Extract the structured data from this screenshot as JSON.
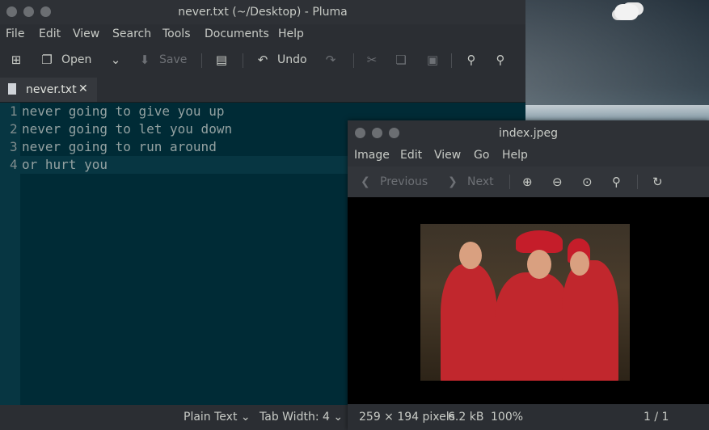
{
  "pluma": {
    "title": "never.txt (~/Desktop) - Pluma",
    "menu": [
      "File",
      "Edit",
      "View",
      "Search",
      "Tools",
      "Documents",
      "Help"
    ],
    "toolbar": {
      "open_label": "Open",
      "save_label": "Save",
      "undo_label": "Undo"
    },
    "tab": {
      "name": "never.txt",
      "close": "✕"
    },
    "lines": [
      {
        "num": "1",
        "text": "never going to give you up"
      },
      {
        "num": "2",
        "text": "never going to let you down"
      },
      {
        "num": "3",
        "text": "never going to run around"
      },
      {
        "num": "4",
        "text": "or hurt you"
      }
    ],
    "status": {
      "syntax": "Plain Text",
      "tab_width": "Tab Width:  4"
    }
  },
  "viewer": {
    "title": "index.jpeg",
    "menu": [
      "Image",
      "Edit",
      "View",
      "Go",
      "Help"
    ],
    "toolbar": {
      "previous_label": "Previous",
      "next_label": "Next"
    },
    "status": {
      "dimensions": "259 × 194 pixels",
      "size": "6.2 kB",
      "zoom": "100%",
      "position": "1 / 1"
    }
  },
  "icons": {
    "new": "new-document-icon",
    "open": "open-folder-icon",
    "save": "save-icon",
    "print": "print-icon",
    "undo": "undo-icon",
    "redo": "redo-icon",
    "cut": "cut-icon",
    "copy": "copy-icon",
    "paste": "paste-icon",
    "find": "search-icon",
    "replace": "search-replace-icon"
  },
  "colors": {
    "editor_bg": "#002b36",
    "current_line": "#073642",
    "text": "#93a1a1"
  }
}
